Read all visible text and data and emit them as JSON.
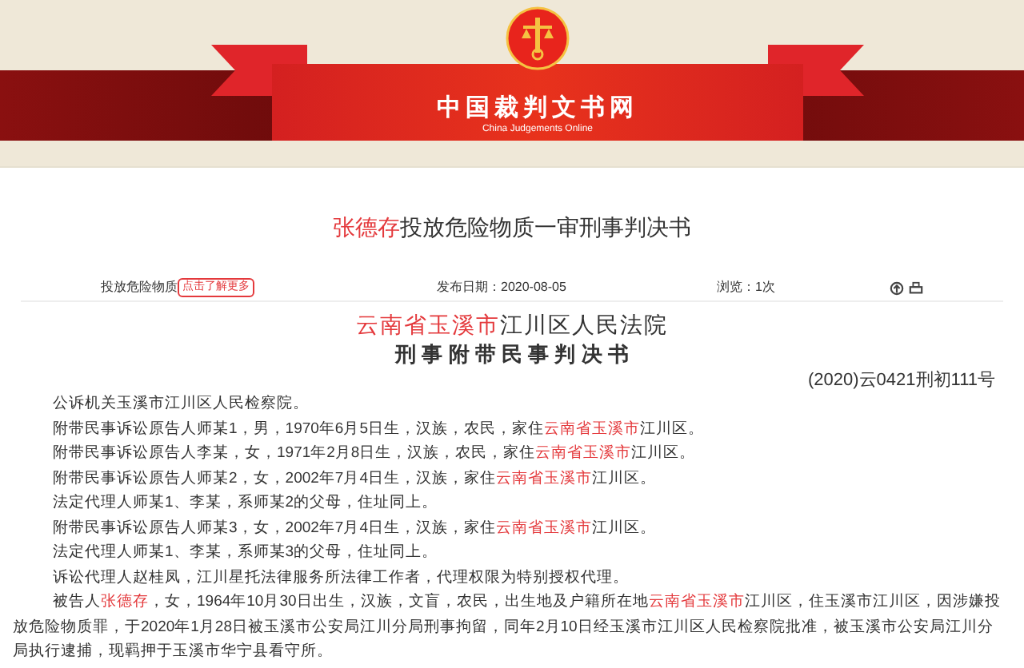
{
  "site": {
    "title": "中国裁判文书网",
    "subtitle": "China Judgements Online"
  },
  "document": {
    "title": [
      {
        "text": "张德存",
        "highlight": true
      },
      {
        "text": "投放危险物质一审刑事判决书",
        "highlight": false
      }
    ],
    "meta": {
      "tag": "投放危险物质",
      "tag_button": "点击了解更多",
      "date": "发布日期：2020-08-05",
      "views": "浏览：1次"
    },
    "court": [
      {
        "text": "云南省玉溪市",
        "highlight": true
      },
      {
        "text": "江川区人民法院",
        "highlight": false
      }
    ],
    "doc_type": "刑 事 附 带 民 事 判 决 书",
    "case_number": "(2020)云0421刑初111号",
    "paragraphs": [
      [
        {
          "text": "公诉机关玉溪市江川区人民检察院。",
          "highlight": false
        }
      ],
      [
        {
          "text": "附带民事诉讼原告人师某1，男，1970年6月5日生，汉族，农民，家住",
          "highlight": false
        },
        {
          "text": "云南省玉溪市",
          "highlight": true
        },
        {
          "text": "江川区。",
          "highlight": false
        }
      ],
      [
        {
          "text": "附带民事诉讼原告人李某，女，1971年2月8日生，汉族，农民，家住",
          "highlight": false
        },
        {
          "text": "云南省玉溪市",
          "highlight": true
        },
        {
          "text": "江川区。",
          "highlight": false
        }
      ],
      [
        {
          "text": "附带民事诉讼原告人师某2，女，2002年7月4日生，汉族，家住",
          "highlight": false
        },
        {
          "text": "云南省玉溪市",
          "highlight": true
        },
        {
          "text": "江川区。",
          "highlight": false
        }
      ],
      [
        {
          "text": "法定代理人师某1、李某，系师某2的父母，住址同上。",
          "highlight": false
        }
      ],
      [
        {
          "text": "附带民事诉讼原告人师某3，女，2002年7月4日生，汉族，家住",
          "highlight": false
        },
        {
          "text": "云南省玉溪市",
          "highlight": true
        },
        {
          "text": "江川区。",
          "highlight": false
        }
      ],
      [
        {
          "text": "法定代理人师某1、李某，系师某3的父母，住址同上。",
          "highlight": false
        }
      ],
      [
        {
          "text": "诉讼代理人赵桂凤，江川星托法律服务所法律工作者，代理权限为特别授权代理。",
          "highlight": false
        }
      ],
      [
        {
          "text": "被告人",
          "highlight": false
        },
        {
          "text": "张德存",
          "highlight": true
        },
        {
          "text": "，女，1964年10月30日出生，汉族，文盲，农民，出生地及户籍所在地",
          "highlight": false
        },
        {
          "text": "云南省玉溪市",
          "highlight": true
        },
        {
          "text": "江川区，住玉溪市江川区，因涉嫌投放危险物质罪，于2020年1月28日被玉溪市公安局江川分局刑事拘留，同年2月10日经玉溪市江川区人民检察院批准，被玉溪市公安局江川分局执行逮捕，现羁押于玉溪市华宁县看守所。",
          "highlight": false
        }
      ]
    ]
  }
}
